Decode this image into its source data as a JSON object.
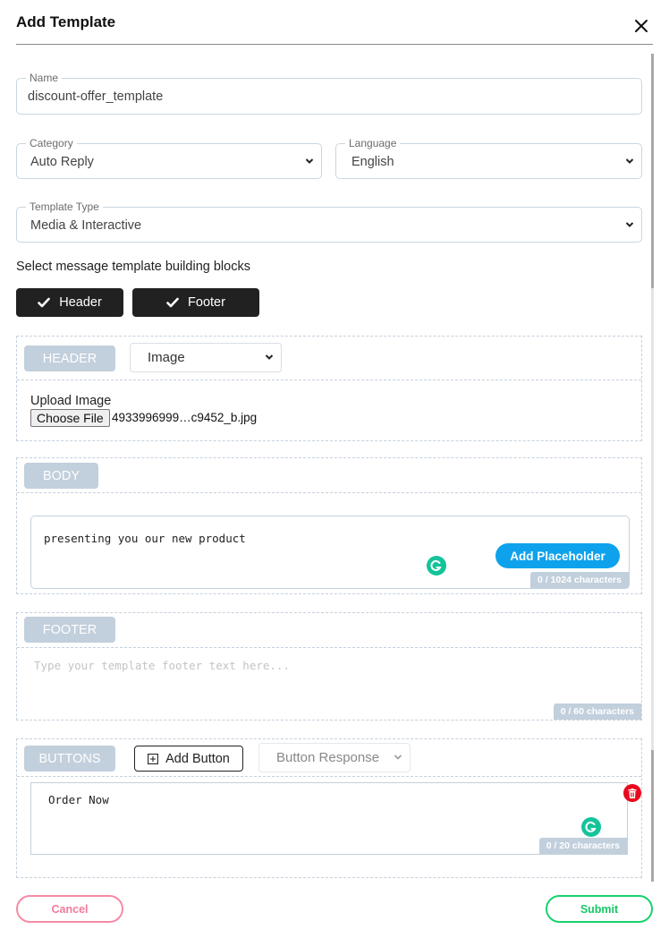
{
  "dialog": {
    "title": "Add Template",
    "close_icon": "close-icon"
  },
  "form": {
    "name": {
      "label": "Name",
      "value": "discount-offer_template"
    },
    "category": {
      "label": "Category",
      "value": "Auto Reply"
    },
    "language": {
      "label": "Language",
      "value": "English"
    },
    "template_type": {
      "label": "Template Type",
      "value": "Media & Interactive"
    }
  },
  "building_blocks": {
    "label": "Select message template building blocks",
    "toggles": [
      {
        "label": "Header",
        "checked": true,
        "icon": "check-icon"
      },
      {
        "label": "Footer",
        "checked": true,
        "icon": "check-icon"
      }
    ]
  },
  "header_section": {
    "tag": "HEADER",
    "media_type": "Image",
    "upload_label": "Upload Image",
    "choose_file_label": "Choose File",
    "file_name": "4933996999…c9452_b.jpg"
  },
  "body_section": {
    "tag": "BODY",
    "text": "presenting you our new product",
    "add_placeholder_label": "Add Placeholder",
    "counter": "0 / 1024 characters"
  },
  "footer_section": {
    "tag": "FOOTER",
    "placeholder": "Type your template footer text here...",
    "counter": "0 / 60 characters"
  },
  "buttons_section": {
    "tag": "BUTTONS",
    "add_button_label": "Add Button",
    "response_type": "Button Response",
    "buttons": [
      {
        "text": "Order Now",
        "counter": "0 / 20 characters"
      }
    ]
  },
  "actions": {
    "cancel_label": "Cancel",
    "submit_label": "Submit"
  },
  "colors": {
    "primary_dark": "#212121",
    "tag_bg": "#c2cfdc",
    "accent_blue": "#0ea2ec",
    "cancel": "#f57a98",
    "submit": "#16c865",
    "delete": "#e8091e",
    "grammarly": "#15c39a"
  }
}
